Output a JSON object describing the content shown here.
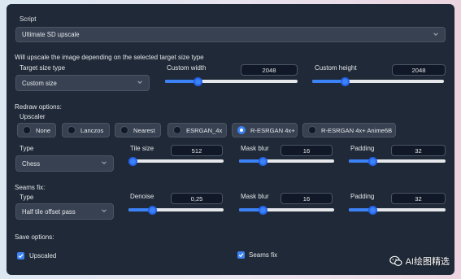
{
  "script_label": "Script",
  "script_value": "Ultimate SD upscale",
  "info_text": "Will upscale the image depending on the selected target size type",
  "target": {
    "type_label": "Target size type",
    "type_value": "Custom size",
    "width_label": "Custom width",
    "width_value": "2048",
    "width_level": 0.25,
    "height_label": "Custom height",
    "height_value": "2048",
    "height_level": 0.25
  },
  "redraw": {
    "heading": "Redraw options:",
    "upscaler_label": "Upscaler",
    "upscalers": [
      "None",
      "Lanczos",
      "Nearest",
      "ESRGAN_4x",
      "R-ESRGAN 4x+",
      "R-ESRGAN 4x+ Anime6B"
    ],
    "selected_upscaler": "R-ESRGAN 4x+",
    "type_label": "Type",
    "type_value": "Chess",
    "tile_size_label": "Tile size",
    "tile_size_value": "512",
    "tile_size_level": 0.05,
    "mask_blur_label": "Mask blur",
    "mask_blur_value": "16",
    "mask_blur_level": 0.25,
    "padding_label": "Padding",
    "padding_value": "32",
    "padding_level": 0.25
  },
  "seams": {
    "heading": "Seams fix:",
    "type_label": "Type",
    "type_value": "Half tile offset pass",
    "denoise_label": "Denoise",
    "denoise_value": "0,25",
    "denoise_level": 0.25,
    "mask_blur_label": "Mask blur",
    "mask_blur_value": "16",
    "mask_blur_level": 0.25,
    "padding_label": "Padding",
    "padding_value": "32",
    "padding_level": 0.25
  },
  "save": {
    "heading": "Save options:",
    "upscaled_label": "Upscaled",
    "upscaled_checked": true,
    "seams_fix_label": "Seams fix",
    "seams_fix_checked": true
  },
  "watermark": "AI绘图精选",
  "colors": {
    "panel": "#1f2937",
    "accent": "#3b82f6",
    "field": "#374151"
  }
}
